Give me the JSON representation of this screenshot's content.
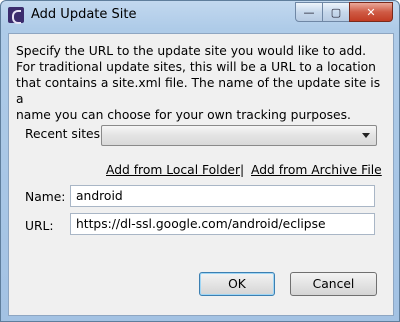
{
  "window": {
    "title": "Add Update Site",
    "minimize_glyph": "—",
    "maximize_glyph": "▢",
    "close_glyph": "✕"
  },
  "description": "Specify the URL to the update site you would like to add.\nFor traditional update sites, this will be a URL to a location\nthat contains a site.xml file.  The name of the update site is a\nname you can choose for your own tracking purposes.",
  "recent_sites": {
    "label": "Recent sites:",
    "selected": ""
  },
  "links": {
    "local_folder": "Add from Local Folder",
    "separator": "|",
    "archive_file": "Add from Archive File"
  },
  "name_field": {
    "label": "Name:",
    "value": "android"
  },
  "url_field": {
    "label": "URL:",
    "value": "https://dl-ssl.google.com/android/eclipse"
  },
  "buttons": {
    "ok": "OK",
    "cancel": "Cancel"
  },
  "colors": {
    "title_bar": "#aecbe8",
    "dialog_bg": "#f0f0f0",
    "close_button": "#c23c24"
  }
}
